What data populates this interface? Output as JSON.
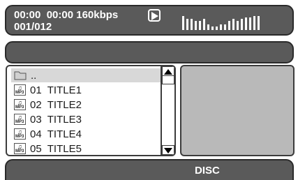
{
  "status": {
    "line1": "00:00  00:00 160kbps",
    "line2": "001/012",
    "play_icon": "play-icon",
    "equalizer_icon": "equalizer-bars-icon"
  },
  "file_list": {
    "items": [
      {
        "icon": "folder-icon",
        "label": ".."
      },
      {
        "icon": "mp3-file-icon",
        "label": "01  TITLE1"
      },
      {
        "icon": "mp3-file-icon",
        "label": "02  TITLE2"
      },
      {
        "icon": "mp3-file-icon",
        "label": "03  TITLE3"
      },
      {
        "icon": "mp3-file-icon",
        "label": "04  TITLE4"
      },
      {
        "icon": "mp3-file-icon",
        "label": "05  TITLE5"
      }
    ],
    "mp3_tag": "MP3"
  },
  "bottom": {
    "label": "DISC"
  },
  "colors": {
    "bar": "#5a5a5a",
    "preview": "#b9b9b9",
    "selected": "#d8d8d8"
  }
}
